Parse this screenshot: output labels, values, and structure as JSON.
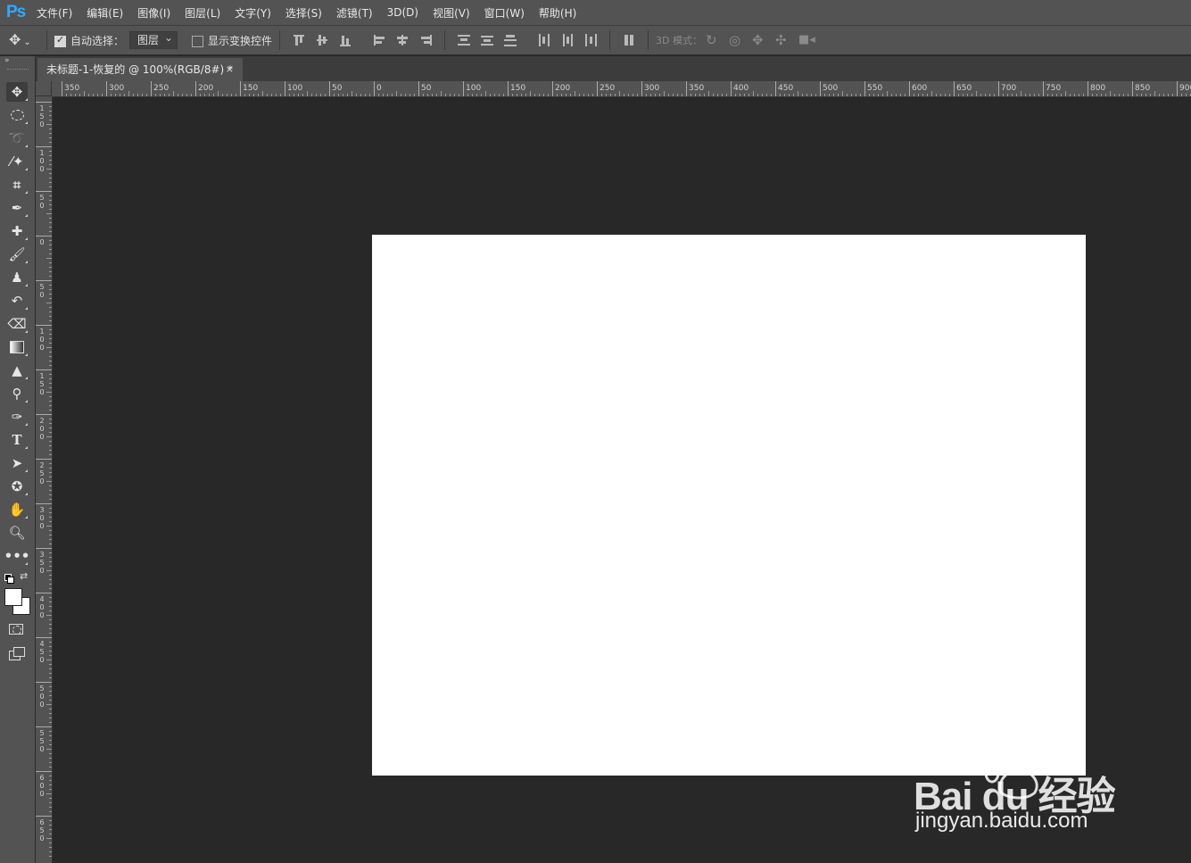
{
  "app": {
    "logo": "Ps"
  },
  "menu": [
    "文件(F)",
    "编辑(E)",
    "图像(I)",
    "图层(L)",
    "文字(Y)",
    "选择(S)",
    "滤镜(T)",
    "3D(D)",
    "视图(V)",
    "窗口(W)",
    "帮助(H)"
  ],
  "options": {
    "auto_select_label": "自动选择：",
    "auto_select_checked": true,
    "auto_select_target": "图层",
    "show_transform_label": "显示变换控件",
    "show_transform_checked": false,
    "mode_3d_label": "3D 模式："
  },
  "document": {
    "tab_title": "未标题-1-恢复的 @ 100%(RGB/8#) *",
    "close_glyph": "×",
    "canvas_color": "#ffffff"
  },
  "rulers": {
    "top_labels": [
      "350",
      "300",
      "250",
      "200",
      "150",
      "100",
      "50",
      "0",
      "50",
      "100",
      "150",
      "200",
      "250",
      "300",
      "350",
      "400",
      "450",
      "500",
      "550",
      "600",
      "650",
      "700",
      "750",
      "800",
      "850",
      "900"
    ],
    "left_labels": [
      "150",
      "100",
      "50",
      "0",
      "50",
      "100",
      "150",
      "200",
      "250",
      "300",
      "350",
      "400",
      "450",
      "500",
      "550",
      "600",
      "650"
    ]
  },
  "tools": [
    "move-tool",
    "marquee-tool",
    "lasso-tool",
    "magic-wand-tool",
    "crop-tool",
    "eyedropper-tool",
    "healing-brush-tool",
    "brush-tool",
    "clone-stamp-tool",
    "history-brush-tool",
    "eraser-tool",
    "gradient-tool",
    "blur-tool",
    "dodge-tool",
    "pen-tool",
    "type-tool",
    "path-selection-tool",
    "shape-tool",
    "hand-tool",
    "zoom-tool",
    "more-tools"
  ],
  "watermark": {
    "brand": "Bai du 经验",
    "url": "jingyan.baidu.com"
  },
  "colors": {
    "accent": "#31a8ff",
    "panel": "#535353",
    "workspace": "#282828"
  }
}
